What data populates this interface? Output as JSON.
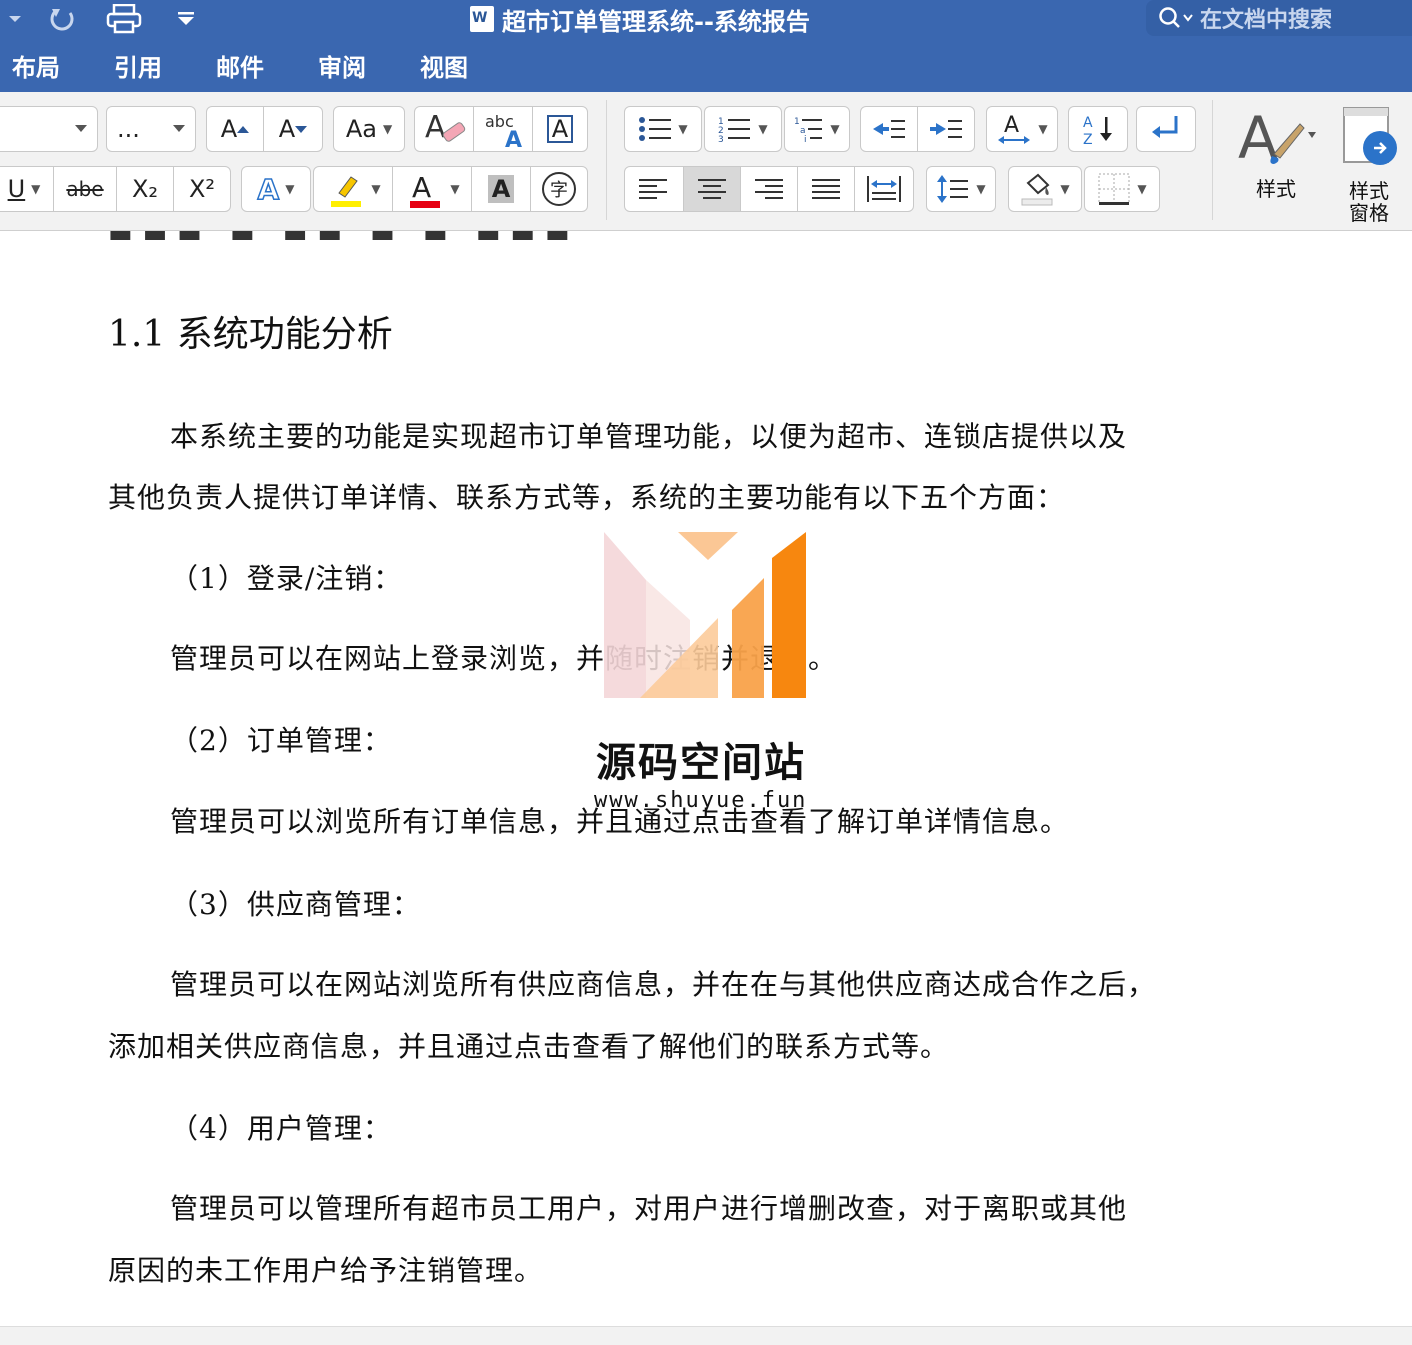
{
  "window": {
    "title": "超市订单管理系统--系统报告",
    "search_placeholder": "在文档中搜索"
  },
  "menu": {
    "tabs": [
      "布局",
      "引用",
      "邮件",
      "审阅",
      "视图"
    ]
  },
  "ribbon": {
    "font_size_value": "...",
    "grow_font": "A",
    "shrink_font": "A",
    "change_case": "Aa",
    "clear_format": "A",
    "abc_label": "abc",
    "char_border": "A",
    "underline": "U",
    "strikethrough": "abe",
    "subscript": "X₂",
    "superscript": "X²",
    "text_effects": "A",
    "font_color": "A",
    "char_shading": "A",
    "enclose_char": "字",
    "sort": "AZ",
    "styles_label": "样式",
    "styles_pane_label_1": "样式",
    "styles_pane_label_2": "窗格",
    "highlight_color": "#ffef00",
    "font_color_value": "#e60012"
  },
  "document": {
    "heading": "1.1  系统功能分析",
    "paragraphs": [
      "本系统主要的功能是实现超市订单管理功能，以便为超市、连锁店提供以及",
      "其他负责人提供订单详情、联系方式等，系统的主要功能有以下五个方面：",
      "（1）登录/注销：",
      "管理员可以在网站上登录浏览，并随时注销并退出。",
      "（2）订单管理：",
      "管理员可以浏览所有订单信息，并且通过点击查看了解订单详情信息。",
      "（3）供应商管理：",
      "管理员可以在网站浏览所有供应商信息，并在在与其他供应商达成合作之后，",
      "添加相关供应商信息，并且通过点击查看了解他们的联系方式等。",
      "（4）用户管理：",
      "管理员可以管理所有超市员工用户，对用户进行增删改查，对于离职或其他",
      "原因的未工作用户给予注销管理。"
    ]
  },
  "watermark": {
    "name": "源码空间站",
    "url": "www.shuyue.fun"
  }
}
